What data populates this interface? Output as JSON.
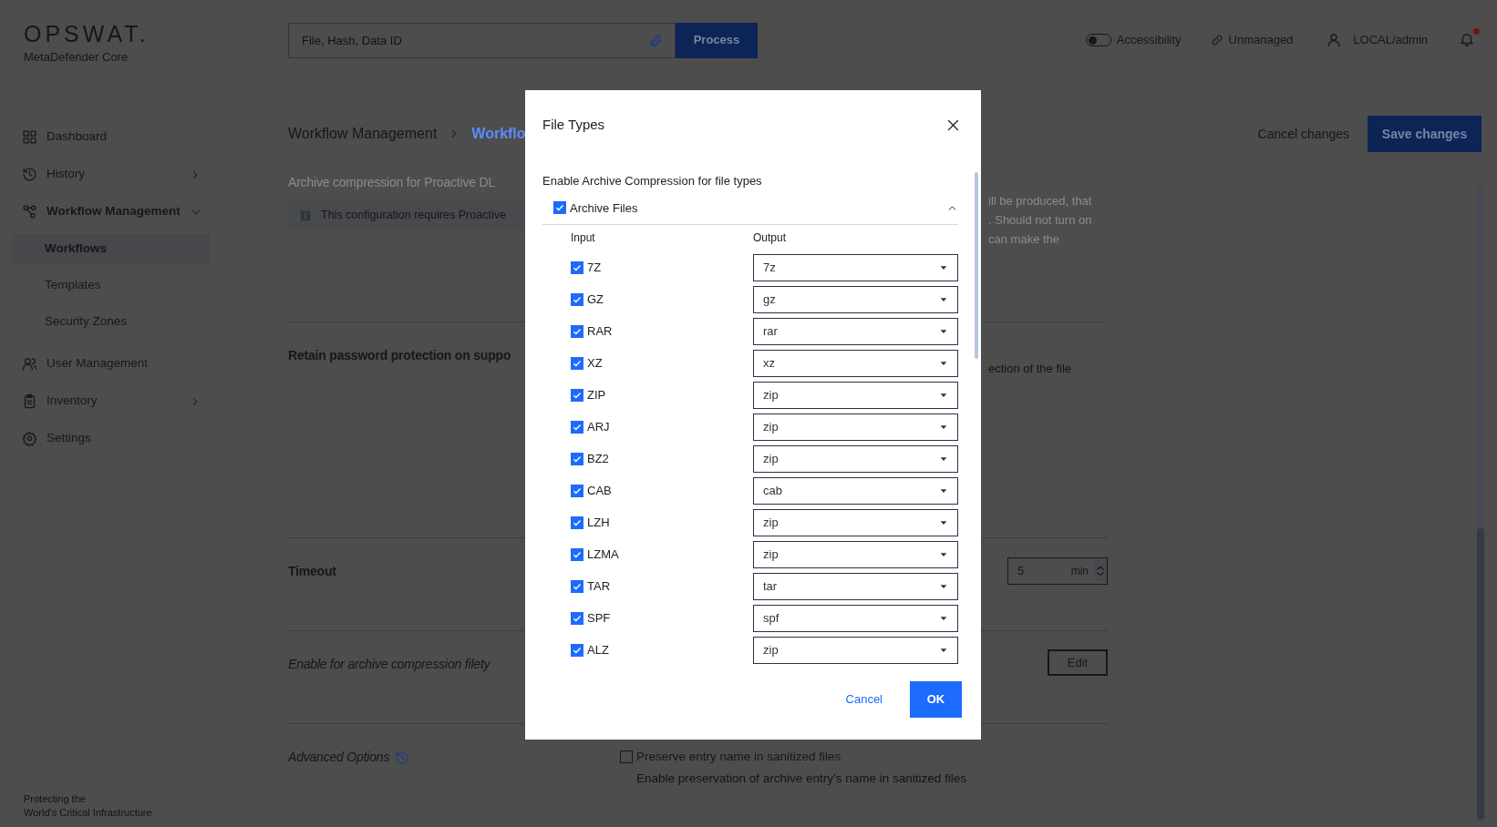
{
  "header": {
    "logo": "OPSWAT.",
    "product": "MetaDefender Core",
    "search": {
      "placeholder": "File, Hash, Data ID"
    },
    "process_button": "Process",
    "accessibility": {
      "label": "Accessibility",
      "on": false
    },
    "unmanaged": "Unmanaged",
    "user": "LOCAL/admin",
    "notifications": {
      "unread": true
    }
  },
  "sidebar": {
    "items": [
      {
        "label": "Dashboard",
        "kind": "link"
      },
      {
        "label": "History",
        "kind": "group",
        "expanded": false
      },
      {
        "label": "Workflow Management",
        "kind": "group",
        "expanded": true,
        "children": [
          {
            "label": "Workflows",
            "selected": true
          },
          {
            "label": "Templates",
            "selected": false
          },
          {
            "label": "Security Zones",
            "selected": false
          }
        ]
      },
      {
        "label": "User Management",
        "kind": "link"
      },
      {
        "label": "Inventory",
        "kind": "group",
        "expanded": false
      },
      {
        "label": "Settings",
        "kind": "link"
      }
    ],
    "footer": [
      "Protecting the",
      "World's Critical Infrastructure"
    ]
  },
  "breadcrumb": [
    "Workflow Management",
    "Workflo"
  ],
  "actions": {
    "cancel": "Cancel changes",
    "save": "Save changes"
  },
  "settings": [
    {
      "kind": "notice",
      "title": "Archive compression for Proactive DL",
      "disabled": true,
      "notice": "This configuration requires Proactive",
      "side_text": [
        "ill be produced, that",
        ". Should not turn on",
        "can make the"
      ]
    },
    {
      "kind": "text",
      "title": "Retain password protection on suppo",
      "side_text": [
        "ection of the file"
      ]
    },
    {
      "kind": "number",
      "title": "Timeout",
      "value": "5",
      "unit": "min"
    },
    {
      "kind": "button",
      "title": "Enable for archive compression filety",
      "button": "Edit"
    },
    {
      "kind": "checkbox",
      "title": "Advanced Options",
      "option": "Preserve entry name in sanitized files",
      "checked": false,
      "description": "Enable preservation of archive entry's name in sanitized files"
    }
  ],
  "dialog": {
    "title": "File Types",
    "subtitle": "Enable Archive Compression for file types",
    "group": {
      "label": "Archive Files",
      "checked": true,
      "expanded": true
    },
    "columns": [
      "Input",
      "Output"
    ],
    "rows": [
      {
        "input": "7Z",
        "checked": true,
        "output": "7z"
      },
      {
        "input": "GZ",
        "checked": true,
        "output": "gz"
      },
      {
        "input": "RAR",
        "checked": true,
        "output": "rar"
      },
      {
        "input": "XZ",
        "checked": true,
        "output": "xz"
      },
      {
        "input": "ZIP",
        "checked": true,
        "output": "zip"
      },
      {
        "input": "ARJ",
        "checked": true,
        "output": "zip"
      },
      {
        "input": "BZ2",
        "checked": true,
        "output": "zip"
      },
      {
        "input": "CAB",
        "checked": true,
        "output": "cab"
      },
      {
        "input": "LZH",
        "checked": true,
        "output": "zip"
      },
      {
        "input": "LZMA",
        "checked": true,
        "output": "zip"
      },
      {
        "input": "TAR",
        "checked": true,
        "output": "tar"
      },
      {
        "input": "SPF",
        "checked": true,
        "output": "spf"
      },
      {
        "input": "ALZ",
        "checked": true,
        "output": "zip"
      }
    ],
    "cancel": "Cancel",
    "ok": "OK"
  }
}
